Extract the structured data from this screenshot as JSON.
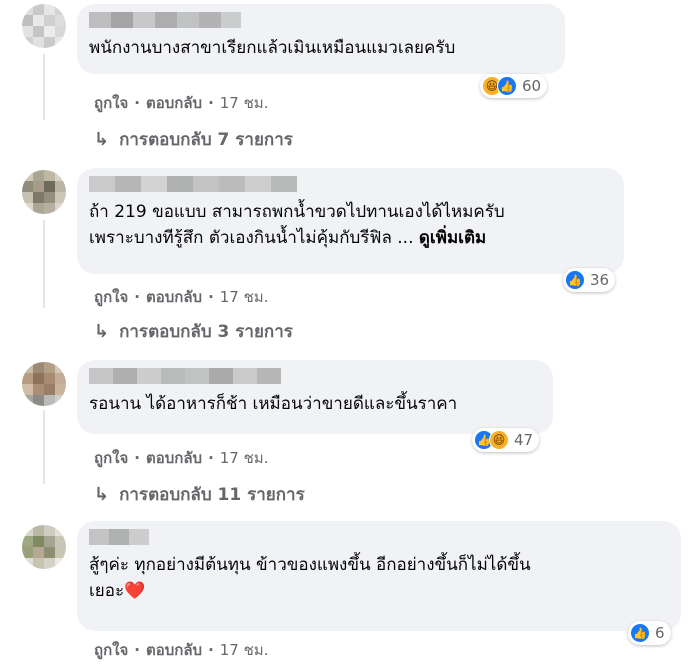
{
  "comments": [
    {
      "text_lines": [
        "พนักงานบางสาขาเรียกแล้วเมินเหมือนแมวเลยครับ"
      ],
      "see_more": "",
      "reactions": [
        "haha-icon",
        "like-icon"
      ],
      "reaction_count": "60",
      "like": "ถูกใจ",
      "reply": "ตอบกลับ",
      "time": "17 ชม.",
      "replies": "การตอบกลับ 7 รายการ"
    },
    {
      "text_lines": [
        "ถ้า 219 ขอแบบ สามารถพกน้ำขวดไปทานเองได้ไหมครับ",
        "เพราะบางทีรู้สึก ตัวเองกินน้ำไม่คุ้มกับรีฟิล ... "
      ],
      "see_more": "ดูเพิ่มเติม",
      "reactions": [
        "like-icon"
      ],
      "reaction_count": "36",
      "like": "ถูกใจ",
      "reply": "ตอบกลับ",
      "time": "17 ชม.",
      "replies": "การตอบกลับ 3 รายการ"
    },
    {
      "text_lines": [
        "รอนาน ได้อาหารก็ช้า เหมือนว่าขายดีและขึ้นราคา"
      ],
      "see_more": "",
      "reactions": [
        "like-icon",
        "haha-icon"
      ],
      "reaction_count": "47",
      "like": "ถูกใจ",
      "reply": "ตอบกลับ",
      "time": "17 ชม.",
      "replies": "การตอบกลับ 11 รายการ"
    },
    {
      "text_lines": [
        "สู้ๆค่ะ ทุกอย่างมีต้นทุน ข้าวของแพงขึ้น อีกอย่างขึ้นก็ไม่ได้ขึ้น",
        "เยอะ❤️"
      ],
      "see_more": "",
      "reactions": [
        "like-icon"
      ],
      "reaction_count": "6",
      "like": "ถูกใจ",
      "reply": "ตอบกลับ",
      "time": "17 ชม.",
      "replies": ""
    }
  ],
  "colors": {
    "bubble": "#f0f2f5",
    "meta": "#65676b",
    "like": "#1877f2",
    "haha": "#f7b125"
  }
}
